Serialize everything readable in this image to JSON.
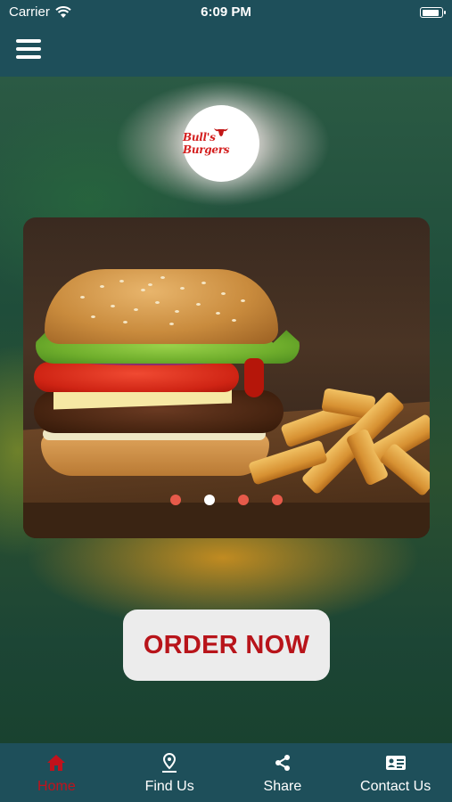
{
  "status_bar": {
    "carrier": "Carrier",
    "time": "6:09 PM",
    "battery_level": 0.9
  },
  "nav": {
    "menu_icon": "hamburger-menu-icon"
  },
  "logo": {
    "text": "Bull's Burgers"
  },
  "carousel": {
    "image_description": "burger-with-fries",
    "slide_count": 4,
    "active_index": 1
  },
  "order_button": {
    "label": "ORDER NOW"
  },
  "tabs": [
    {
      "label": "Home",
      "icon": "home-icon",
      "active": true
    },
    {
      "label": "Find Us",
      "icon": "location-pin-icon",
      "active": false
    },
    {
      "label": "Share",
      "icon": "share-icon",
      "active": false
    },
    {
      "label": "Contact Us",
      "icon": "contact-card-icon",
      "active": false
    }
  ],
  "colors": {
    "bar_bg": "#1e4f5a",
    "accent_red": "#c1121c",
    "dot_inactive": "#e65a4a",
    "dot_active": "#ffffff"
  }
}
